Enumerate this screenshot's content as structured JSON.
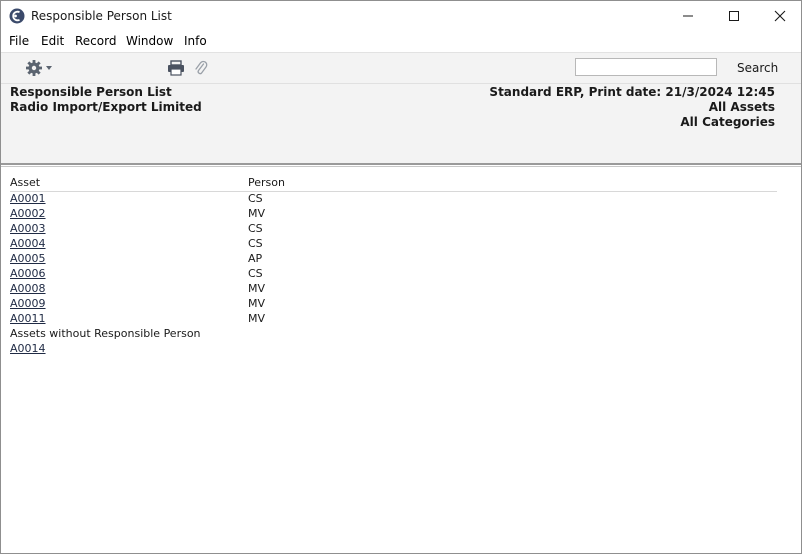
{
  "window": {
    "title": "Responsible Person List",
    "icons": {
      "app": "app-logo-icon",
      "minimize": "minimize-icon",
      "maximize": "maximize-icon",
      "close": "close-icon"
    }
  },
  "menu": [
    "File",
    "Edit",
    "Record",
    "Window",
    "Info"
  ],
  "toolbar": {
    "icons": {
      "operations": "gear-icon",
      "print": "print-icon",
      "attach": "paperclip-icon"
    },
    "search": {
      "value": "",
      "placeholder": ""
    },
    "search_label": "Search"
  },
  "report": {
    "title": "Responsible Person List",
    "company": "Radio Import/Export Limited",
    "system_line": "Standard ERP, Print date: 21/3/2024 12:45",
    "assets_filter": "All Assets",
    "categories_filter": "All Categories",
    "columns": {
      "asset": "Asset",
      "person": "Person"
    },
    "rows": [
      {
        "asset": "A0001",
        "person": "CS"
      },
      {
        "asset": "A0002",
        "person": "MV"
      },
      {
        "asset": "A0003",
        "person": "CS"
      },
      {
        "asset": "A0004",
        "person": "CS"
      },
      {
        "asset": "A0005",
        "person": "AP"
      },
      {
        "asset": "A0006",
        "person": "CS"
      },
      {
        "asset": "A0008",
        "person": "MV"
      },
      {
        "asset": "A0009",
        "person": "MV"
      },
      {
        "asset": "A0011",
        "person": "MV"
      }
    ],
    "without_section_label": "Assets without Responsible Person",
    "without_rows": [
      {
        "asset": "A0014"
      }
    ]
  }
}
